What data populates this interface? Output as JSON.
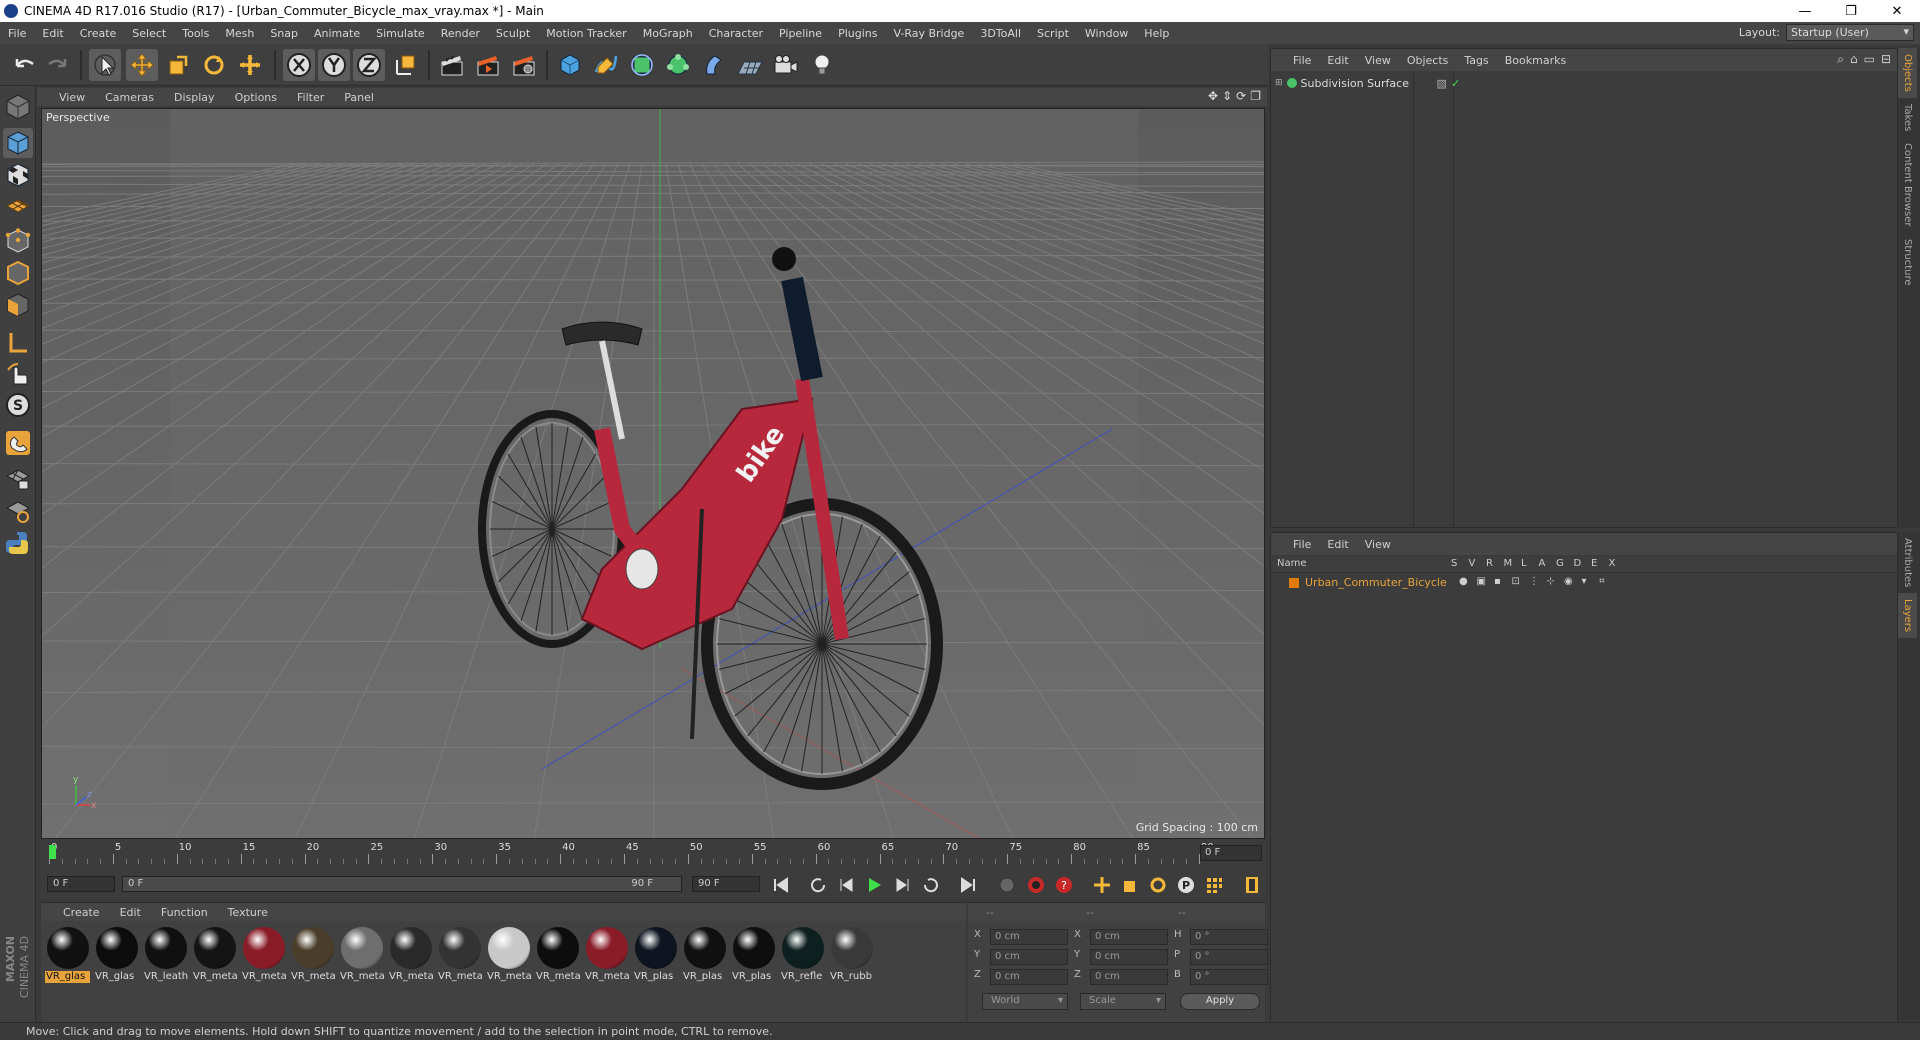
{
  "window": {
    "title": "CINEMA 4D R17.016 Studio (R17) - [Urban_Commuter_Bicycle_max_vray.max *] - Main",
    "minimize": "—",
    "maximize": "❐",
    "close": "✕"
  },
  "menu": {
    "items": [
      "File",
      "Edit",
      "Create",
      "Select",
      "Tools",
      "Mesh",
      "Snap",
      "Animate",
      "Simulate",
      "Render",
      "Sculpt",
      "Motion Tracker",
      "MoGraph",
      "Character",
      "Pipeline",
      "Plugins",
      "V-Ray Bridge",
      "3DToAll",
      "Script",
      "Window",
      "Help"
    ],
    "layout_label": "Layout:",
    "layout_value": "Startup (User)"
  },
  "viewport": {
    "menu": [
      "View",
      "Cameras",
      "Display",
      "Options",
      "Filter",
      "Panel"
    ],
    "label": "Perspective",
    "grid_spacing": "Grid Spacing : 100 cm",
    "axis_x": "x",
    "axis_y": "y",
    "axis_z": "z",
    "bike_text": "bike"
  },
  "timeline": {
    "ticks": [
      "0",
      "5",
      "10",
      "15",
      "20",
      "25",
      "30",
      "35",
      "40",
      "45",
      "50",
      "55",
      "60",
      "65",
      "70",
      "75",
      "80",
      "85",
      "90"
    ],
    "current_frame": "0 F",
    "start_field": "0 F",
    "range_start": "0 F",
    "range_end": "90 F",
    "end_field": "90 F",
    "current_field": "0 F"
  },
  "materials": {
    "menu": [
      "Create",
      "Edit",
      "Function",
      "Texture"
    ],
    "items": [
      {
        "label": "VR_glas",
        "color": "#111111",
        "selected": true
      },
      {
        "label": "VR_glas",
        "color": "#0c0c0c"
      },
      {
        "label": "VR_leath",
        "color": "#101010"
      },
      {
        "label": "VR_meta",
        "color": "#141414"
      },
      {
        "label": "VR_meta",
        "color": "#8a1c28"
      },
      {
        "label": "VR_meta",
        "color": "#4a3e2a"
      },
      {
        "label": "VR_meta",
        "color": "#6e6e6e"
      },
      {
        "label": "VR_meta",
        "color": "#2a2a2a"
      },
      {
        "label": "VR_meta",
        "color": "#333333"
      },
      {
        "label": "VR_meta",
        "color": "#c8c8c8"
      },
      {
        "label": "VR_meta",
        "color": "#0d0d0d"
      },
      {
        "label": "VR_meta",
        "color": "#8a1c28"
      },
      {
        "label": "VR_plas",
        "color": "#0e1420"
      },
      {
        "label": "VR_plas",
        "color": "#101010"
      },
      {
        "label": "VR_plas",
        "color": "#0e0e0e"
      },
      {
        "label": "VR_refle",
        "color": "#0d1f1f"
      },
      {
        "label": "VR_rubb",
        "color": "#3a3a3a"
      }
    ]
  },
  "coordinates": {
    "headers": [
      "--",
      "--",
      "--"
    ],
    "rows": [
      {
        "l1": "X",
        "v1": "0 cm",
        "l2": "X",
        "v2": "0 cm",
        "l3": "H",
        "v3": "0 °"
      },
      {
        "l1": "Y",
        "v1": "0 cm",
        "l2": "Y",
        "v2": "0 cm",
        "l3": "P",
        "v3": "0 °"
      },
      {
        "l1": "Z",
        "v1": "0 cm",
        "l2": "Z",
        "v2": "0 cm",
        "l3": "B",
        "v3": "0 °"
      }
    ],
    "world": "World",
    "scale": "Scale",
    "apply": "Apply"
  },
  "objects_panel": {
    "menu": [
      "File",
      "Edit",
      "View",
      "Objects",
      "Tags",
      "Bookmarks"
    ],
    "items": [
      {
        "name": "Subdivision Surface"
      }
    ]
  },
  "layers_panel": {
    "menu": [
      "File",
      "Edit",
      "View"
    ],
    "columns": [
      "Name",
      "S",
      "V",
      "R",
      "M",
      "L",
      "A",
      "G",
      "D",
      "E",
      "X"
    ],
    "items": [
      {
        "name": "Urban_Commuter_Bicycle",
        "color": "#e07a00"
      }
    ]
  },
  "side_tabs_top": [
    "Objects",
    "Takes",
    "Content Browser",
    "Structure"
  ],
  "side_tabs_bottom": [
    "Attributes",
    "Layers"
  ],
  "branding": {
    "maxon": "MAXON",
    "c4d": "CINEMA 4D"
  },
  "status": "Move: Click and drag to move elements. Hold down SHIFT to quantize movement / add to the selection in point mode, CTRL to remove.",
  "colors": {
    "accent": "#e8a33a",
    "axis_x": "#e04040",
    "axis_y": "#40c040",
    "axis_z": "#4060e0",
    "frame": "#c0283a"
  }
}
